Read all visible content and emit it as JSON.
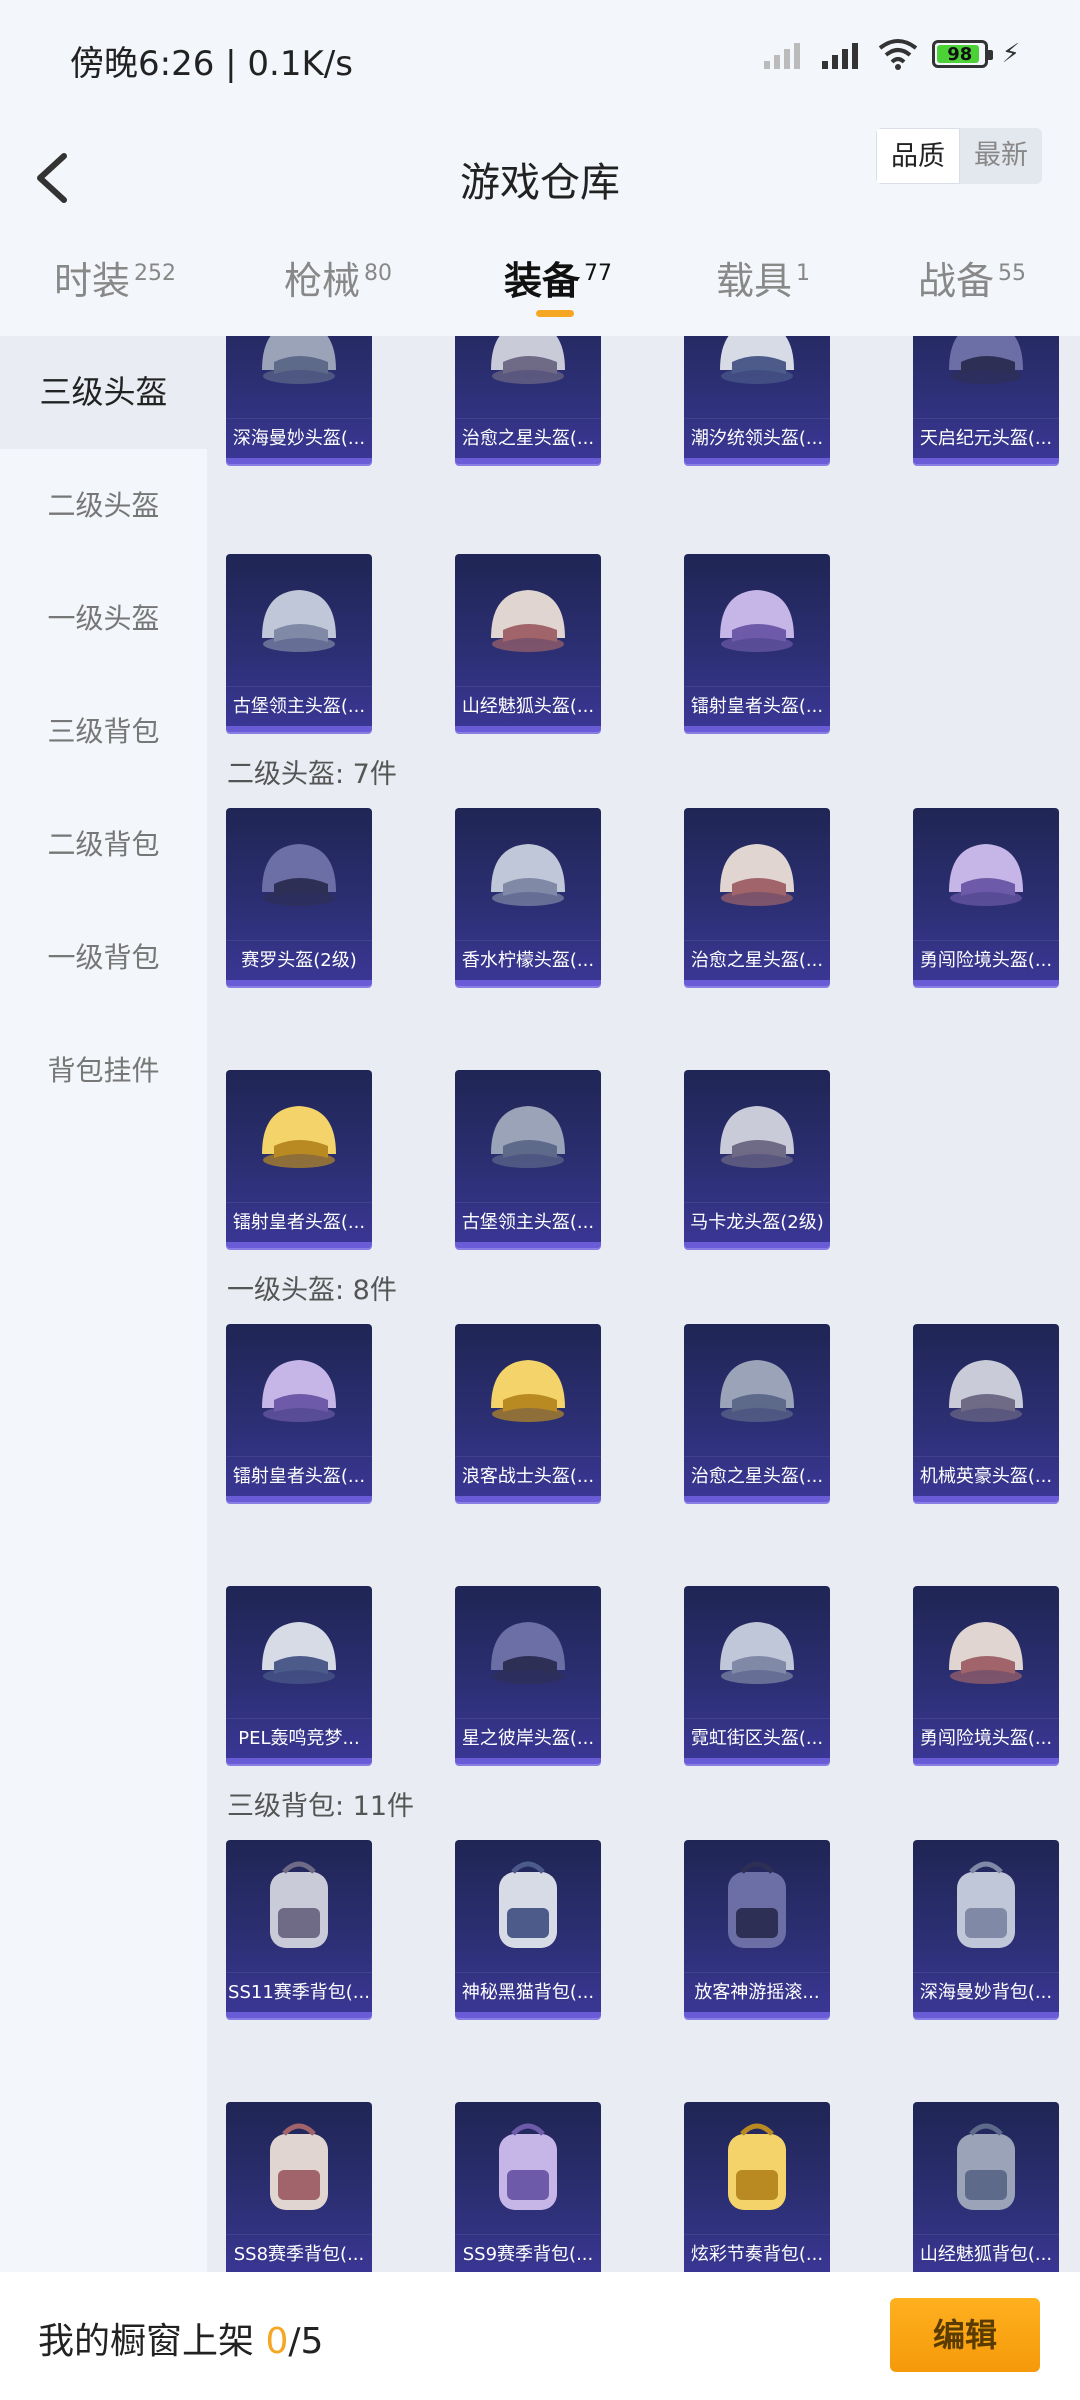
{
  "status": {
    "time": "傍晚6:26 | 0.1K/s",
    "battery": "98"
  },
  "header": {
    "title": "游戏仓库",
    "sort_quality": "品质",
    "sort_latest": "最新"
  },
  "tabs": [
    {
      "label": "时装",
      "count": "252"
    },
    {
      "label": "枪械",
      "count": "80"
    },
    {
      "label": "装备",
      "count": "77"
    },
    {
      "label": "载具",
      "count": "1"
    },
    {
      "label": "战备",
      "count": "55"
    }
  ],
  "sidebar": [
    "三级头盔",
    "二级头盔",
    "一级头盔",
    "三级背包",
    "二级背包",
    "一级背包",
    "背包挂件"
  ],
  "sections": [
    {
      "title": "",
      "items": [
        "深海曼妙头盔(...",
        "治愈之星头盔(...",
        "潮汐统领头盔(...",
        "天启纪元头盔(...",
        "古堡领主头盔(...",
        "山经魅狐头盔(...",
        "镭射皇者头盔(..."
      ]
    },
    {
      "title": "二级头盔: 7件",
      "items": [
        "赛罗头盔(2级)",
        "香水柠檬头盔(...",
        "治愈之星头盔(...",
        "勇闯险境头盔(...",
        "镭射皇者头盔(...",
        "古堡领主头盔(...",
        "马卡龙头盔(2级)"
      ]
    },
    {
      "title": "一级头盔: 8件",
      "items": [
        "镭射皇者头盔(...",
        "浪客战士头盔(...",
        "治愈之星头盔(...",
        "机械英豪头盔(...",
        "PEL轰鸣竞梦...",
        "星之彼岸头盔(...",
        "霓虹街区头盔(...",
        "勇闯险境头盔(..."
      ]
    },
    {
      "title": "三级背包: 11件",
      "items": [
        "SS11赛季背包(...",
        "神秘黑猫背包(...",
        "放客神游摇滚...",
        "深海曼妙背包(...",
        "SS8赛季背包(...",
        "SS9赛季背包(...",
        "炫彩节奏背包(...",
        "山经魅狐背包(..."
      ]
    }
  ],
  "bottom": {
    "label_prefix": "我的橱窗上架 ",
    "count": "0",
    "total": "/5",
    "edit": "编辑"
  }
}
